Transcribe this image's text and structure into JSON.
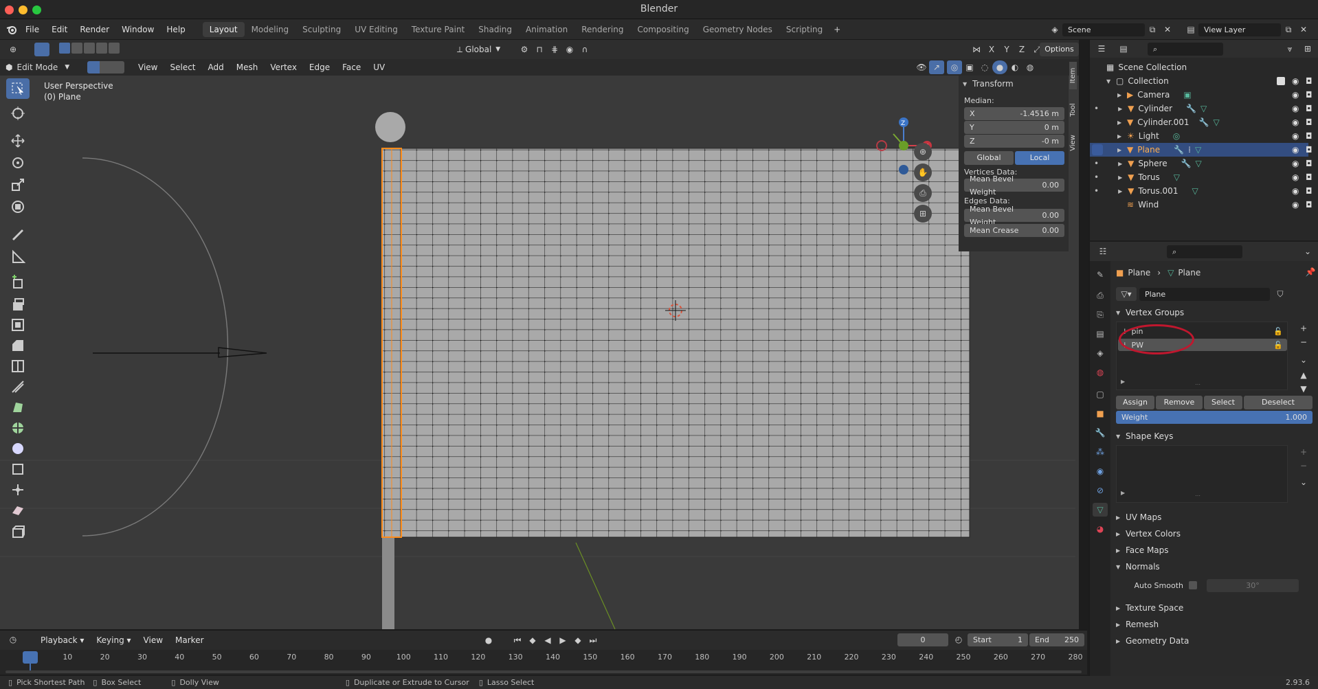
{
  "window": {
    "title": "Blender"
  },
  "menu": {
    "file": "File",
    "edit": "Edit",
    "render": "Render",
    "window": "Window",
    "help": "Help"
  },
  "workspaces": [
    "Layout",
    "Modeling",
    "Sculpting",
    "UV Editing",
    "Texture Paint",
    "Shading",
    "Animation",
    "Rendering",
    "Compositing",
    "Geometry Nodes",
    "Scripting"
  ],
  "scene": {
    "name": "Scene",
    "view_layer": "View Layer"
  },
  "viewport_header": {
    "mode": "Edit Mode",
    "menus": [
      "View",
      "Select",
      "Add",
      "Mesh",
      "Vertex",
      "Edge",
      "Face",
      "UV"
    ],
    "orientation": "Global",
    "options": "Options",
    "axis_x": "X",
    "axis_y": "Y",
    "axis_z": "Z"
  },
  "viewport": {
    "perspective": "User Perspective",
    "object": "(0) Plane"
  },
  "sidebar_tabs": [
    "Item",
    "Tool",
    "View"
  ],
  "transform": {
    "title": "Transform",
    "median_label": "Median:",
    "x_label": "X",
    "x_value": "-1.4516 m",
    "y_label": "Y",
    "y_value": "0 m",
    "z_label": "Z",
    "z_value": "-0 m",
    "global": "Global",
    "local": "Local",
    "vertices_label": "Vertices Data:",
    "mean_bevel_weight": "Mean Bevel Weight",
    "mbw_v": "0.00",
    "edges_label": "Edges Data:",
    "edge_bevel_weight": "Mean Bevel Weight",
    "ebw_v": "0.00",
    "mean_crease": "Mean Crease",
    "crease_v": "0.00"
  },
  "outliner": {
    "scene_collection": "Scene Collection",
    "collection": "Collection",
    "items": [
      "Camera",
      "Cylinder",
      "Cylinder.001",
      "Light",
      "Plane",
      "Sphere",
      "Torus",
      "Torus.001",
      "Wind"
    ]
  },
  "properties": {
    "breadcrumb_object": "Plane",
    "breadcrumb_data": "Plane",
    "mesh_name": "Plane",
    "vertex_groups": "Vertex Groups",
    "groups": [
      "pin",
      "PW"
    ],
    "assign": "Assign",
    "remove": "Remove",
    "select": "Select",
    "deselect": "Deselect",
    "weight_label": "Weight",
    "weight_value": "1.000",
    "shape_keys": "Shape Keys",
    "uv_maps": "UV Maps",
    "vertex_colors": "Vertex Colors",
    "face_maps": "Face Maps",
    "normals": "Normals",
    "auto_smooth": "Auto Smooth",
    "angle": "30°",
    "texture_space": "Texture Space",
    "remesh": "Remesh",
    "geometry_data": "Geometry Data"
  },
  "timeline": {
    "playback": "Playback",
    "keying": "Keying",
    "view": "View",
    "marker": "Marker",
    "current_frame": "0",
    "start_label": "Start",
    "start": "1",
    "end_label": "End",
    "end": "250",
    "ticks": [
      "0",
      "10",
      "20",
      "30",
      "40",
      "50",
      "60",
      "70",
      "80",
      "90",
      "100",
      "110",
      "120",
      "130",
      "140",
      "150",
      "160",
      "170",
      "180",
      "190",
      "200",
      "210",
      "220",
      "230",
      "240",
      "250",
      "260",
      "270",
      "280"
    ]
  },
  "statusbar": {
    "pick": "Pick Shortest Path",
    "box": "Box Select",
    "dolly": "Dolly View",
    "dup": "Duplicate or Extrude to Cursor",
    "lasso": "Lasso Select",
    "version": "2.93.6"
  },
  "colors": {
    "accent": "#4772b3",
    "selection": "#334d80",
    "orange": "#ff8c1a",
    "annot": "#c0172e"
  }
}
